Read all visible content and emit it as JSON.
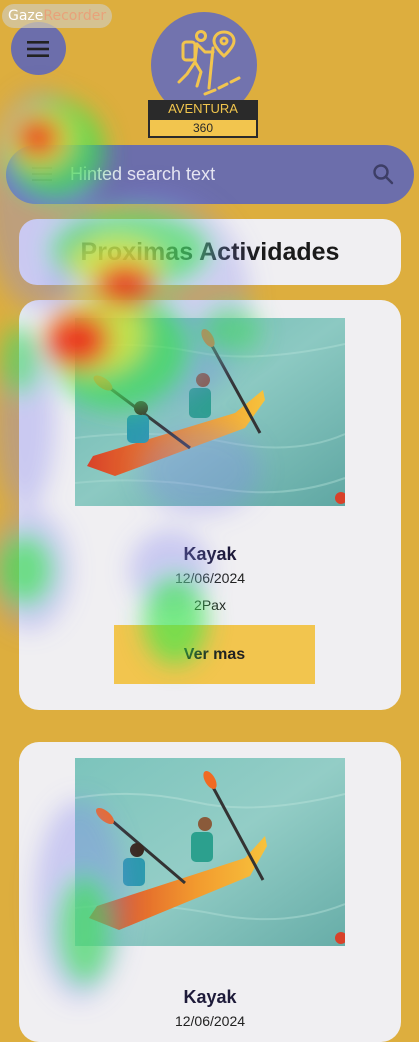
{
  "watermark": {
    "part1": "Gaze",
    "part2": "Recorder"
  },
  "header": {
    "menu_icon": "hamburger-icon",
    "logo": {
      "name": "AVENTURA",
      "number": "360",
      "icon": "hiker-location-icon"
    }
  },
  "search": {
    "placeholder": "Hinted search text",
    "value": "",
    "icon": "search-icon"
  },
  "section": {
    "title": "Proximas Actividades"
  },
  "cards": [
    {
      "title": "Kayak",
      "date": "12/06/2024",
      "pax": "2Pax",
      "button_label": "Ver mas"
    },
    {
      "title": "Kayak",
      "date": "12/06/2024"
    }
  ],
  "colors": {
    "background": "#DDAE3E",
    "primary": "#6C6EAB",
    "card": "#F0EFF2",
    "button": "#F2C54E"
  }
}
